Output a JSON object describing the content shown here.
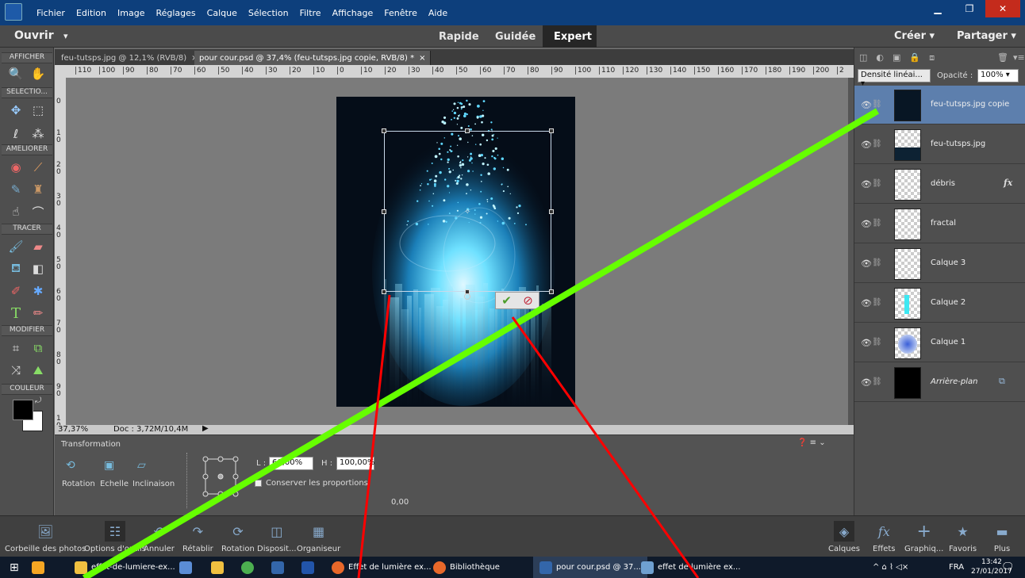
{
  "menu": [
    "Fichier",
    "Edition",
    "Image",
    "Réglages",
    "Calque",
    "Sélection",
    "Filtre",
    "Affichage",
    "Fenêtre",
    "Aide"
  ],
  "modebar": {
    "open_label": "Ouvrir",
    "modes": [
      "Rapide",
      "Guidée",
      "Expert"
    ],
    "active_mode": "Expert",
    "create_label": "Créer",
    "share_label": "Partager"
  },
  "toolbox": {
    "sections": [
      "AFFICHER",
      "SELECTIO...",
      "AMELIORER",
      "TRACER",
      "MODIFIER",
      "COULEUR"
    ]
  },
  "tabs": [
    {
      "label": "feu-tutsps.jpg @ 12,1% (RVB/8)",
      "close": "×"
    },
    {
      "label": "pour cour.psd @ 37,4% (feu-tutsps.jpg copie, RVB/8) *",
      "close": "×"
    }
  ],
  "ruler_h": [
    "110",
    "100",
    "90",
    "80",
    "70",
    "60",
    "50",
    "40",
    "30",
    "20",
    "10",
    "0",
    "10",
    "20",
    "30",
    "40",
    "50",
    "60",
    "70",
    "80",
    "90",
    "100",
    "110",
    "120",
    "130",
    "140",
    "150",
    "160",
    "170",
    "180",
    "190",
    "200",
    "2"
  ],
  "ruler_v": [
    "0",
    "1\n0",
    "2\n0",
    "3\n0",
    "4\n0",
    "5\n0",
    "6\n0",
    "7\n0",
    "8\n0",
    "9\n0",
    "1\n0"
  ],
  "status": {
    "zoom": "37,37%",
    "doc": "Doc : 3,72M/10,4M"
  },
  "transform": {
    "title": "Transformation",
    "buttons": [
      "Rotation",
      "Echelle",
      "Inclinaison"
    ],
    "width_label": "L :",
    "width_value": "60,00%",
    "height_label": "H :",
    "height_value": "100,00%",
    "keep_proportions": "Conserver les proportions",
    "angle_value": "0,00"
  },
  "layers_panel": {
    "blend_mode": "Densité linéai...",
    "opacity_label": "Opacité :",
    "opacity_value": "100%",
    "layers": [
      {
        "name": "feu-tutsps.jpg copie",
        "selected": true
      },
      {
        "name": "feu-tutsps.jpg",
        "selected": false
      },
      {
        "name": "débris",
        "selected": false,
        "fx": "fx"
      },
      {
        "name": "fractal",
        "selected": false
      },
      {
        "name": "Calque 3",
        "selected": false
      },
      {
        "name": "Calque 2",
        "selected": false
      },
      {
        "name": "Calque 1",
        "selected": false
      },
      {
        "name": "Arrière-plan",
        "selected": false,
        "italic": true
      }
    ]
  },
  "bottombar": {
    "left": [
      "Corbeille des photos",
      "Options d'outils",
      "Annuler",
      "Rétablir",
      "Rotation",
      "Disposit...",
      "Organiseur"
    ],
    "right": [
      "Calques",
      "Effets",
      "Graphiq...",
      "Favoris",
      "Plus"
    ]
  },
  "taskbar": {
    "items": [
      "effet-de-lumiere-ex...",
      "Effet de lumière ex...",
      "Bibliothèque",
      "pour cour.psd @ 37...",
      "effet de lumière ex..."
    ],
    "lang": "FRA",
    "time": "13:42",
    "date": "27/01/2017"
  },
  "colors": {
    "titlebar": "#0d3f7c",
    "selected_layer": "#5d7fad",
    "annot_green": "#66ff00",
    "annot_red": "#ff0000"
  }
}
